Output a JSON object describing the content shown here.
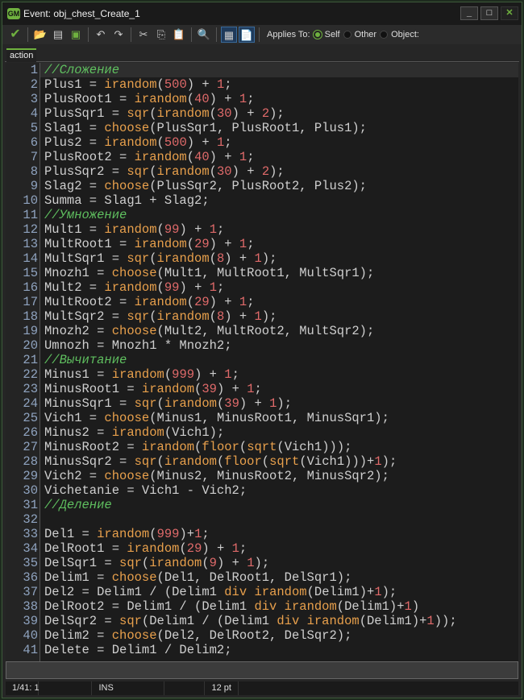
{
  "window": {
    "title": "Event: obj_chest_Create_1",
    "logo": "GM"
  },
  "toolbar": {
    "icons": [
      "check-icon",
      "open-icon",
      "save-icon",
      "print-icon",
      "undo-icon",
      "redo-icon",
      "cut-icon",
      "copy-icon",
      "paste-icon",
      "find-icon",
      "code-view-icon",
      "script-icon"
    ],
    "applies_to": "Applies To:",
    "self": "Self",
    "other": "Other",
    "object": "Object:",
    "selected": "Self",
    "accent": "#6fb13f"
  },
  "tab": {
    "label": "action"
  },
  "code": [
    "//Сложение",
    "Plus1 = irandom(500) + 1;",
    "PlusRoot1 = irandom(40) + 1;",
    "PlusSqr1 = sqr(irandom(30) + 2);",
    "Slag1 = choose(PlusSqr1, PlusRoot1, Plus1);",
    "Plus2 = irandom(500) + 1;",
    "PlusRoot2 = irandom(40) + 1;",
    "PlusSqr2 = sqr(irandom(30) + 2);",
    "Slag2 = choose(PlusSqr2, PlusRoot2, Plus2);",
    "Summa = Slag1 + Slag2;",
    "//Умножение",
    "Mult1 = irandom(99) + 1;",
    "MultRoot1 = irandom(29) + 1;",
    "MultSqr1 = sqr(irandom(8) + 1);",
    "Mnozh1 = choose(Mult1, MultRoot1, MultSqr1);",
    "Mult2 = irandom(99) + 1;",
    "MultRoot2 = irandom(29) + 1;",
    "MultSqr2 = sqr(irandom(8) + 1);",
    "Mnozh2 = choose(Mult2, MultRoot2, MultSqr2);",
    "Umnozh = Mnozh1 * Mnozh2;",
    "//Вычитание",
    "Minus1 = irandom(999) + 1;",
    "MinusRoot1 = irandom(39) + 1;",
    "MinusSqr1 = sqr(irandom(39) + 1);",
    "Vich1 = choose(Minus1, MinusRoot1, MinusSqr1);",
    "Minus2 = irandom(Vich1);",
    "MinusRoot2 = irandom(floor(sqrt(Vich1)));",
    "MinusSqr2 = sqr(irandom(floor(sqrt(Vich1)))+1);",
    "Vich2 = choose(Minus2, MinusRoot2, MinusSqr2);",
    "Vichetanie = Vich1 - Vich2;",
    "//Деление",
    "",
    "Del1 = irandom(999)+1;",
    "DelRoot1 = irandom(29) + 1;",
    "DelSqr1 = sqr(irandom(9) + 1);",
    "Delim1 = choose(Del1, DelRoot1, DelSqr1);",
    "Del2 = Delim1 / (Delim1 div irandom(Delim1)+1);",
    "DelRoot2 = Delim1 / (Delim1 div irandom(Delim1)+1)",
    "DelSqr2 = sqr(Delim1 / (Delim1 div irandom(Delim1)+1));",
    "Delim2 = choose(Del2, DelRoot2, DelSqr2);",
    "Delete = Delim1 / Delim2;"
  ],
  "status": {
    "position": "1/41:",
    "col": "1",
    "mode": "INS",
    "font_size": "12 pt"
  }
}
